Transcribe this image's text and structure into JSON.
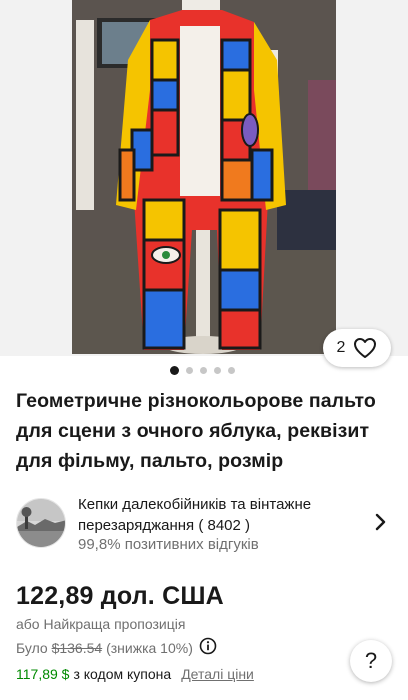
{
  "listing": {
    "image_alt": "Geometric multicolor coat on mannequin",
    "watch_count": "2",
    "gallery": {
      "total": 5,
      "active": 1
    },
    "title": "Геометричне різнокольорове пальто для сцени з очного яблука, реквізит для фільму, пальто, розмір"
  },
  "seller": {
    "name_prefix": "Кепки далекобійників та вінтажне перезаряджання",
    "score": "( 8402 )",
    "feedback_pct": "99,8%",
    "feedback_label": "позитивних відгуків"
  },
  "pricing": {
    "price": "122,89 дол. США",
    "best_offer": "або Найкраща пропозиція",
    "was_label": "Було",
    "was_price": "$136.54",
    "discount": "(знижка 10%)",
    "coupon_price": "117,89 $",
    "coupon_text": "з кодом купона",
    "coupon_link": "Деталі ціни"
  },
  "colors": {
    "accent_green": "#008a00",
    "text": "#191919",
    "muted": "#707070"
  },
  "icons": {
    "like": "heart-icon",
    "info": "info-icon",
    "chevron": "chevron-right-icon",
    "help": "help-icon"
  },
  "help": {
    "label": "?"
  }
}
